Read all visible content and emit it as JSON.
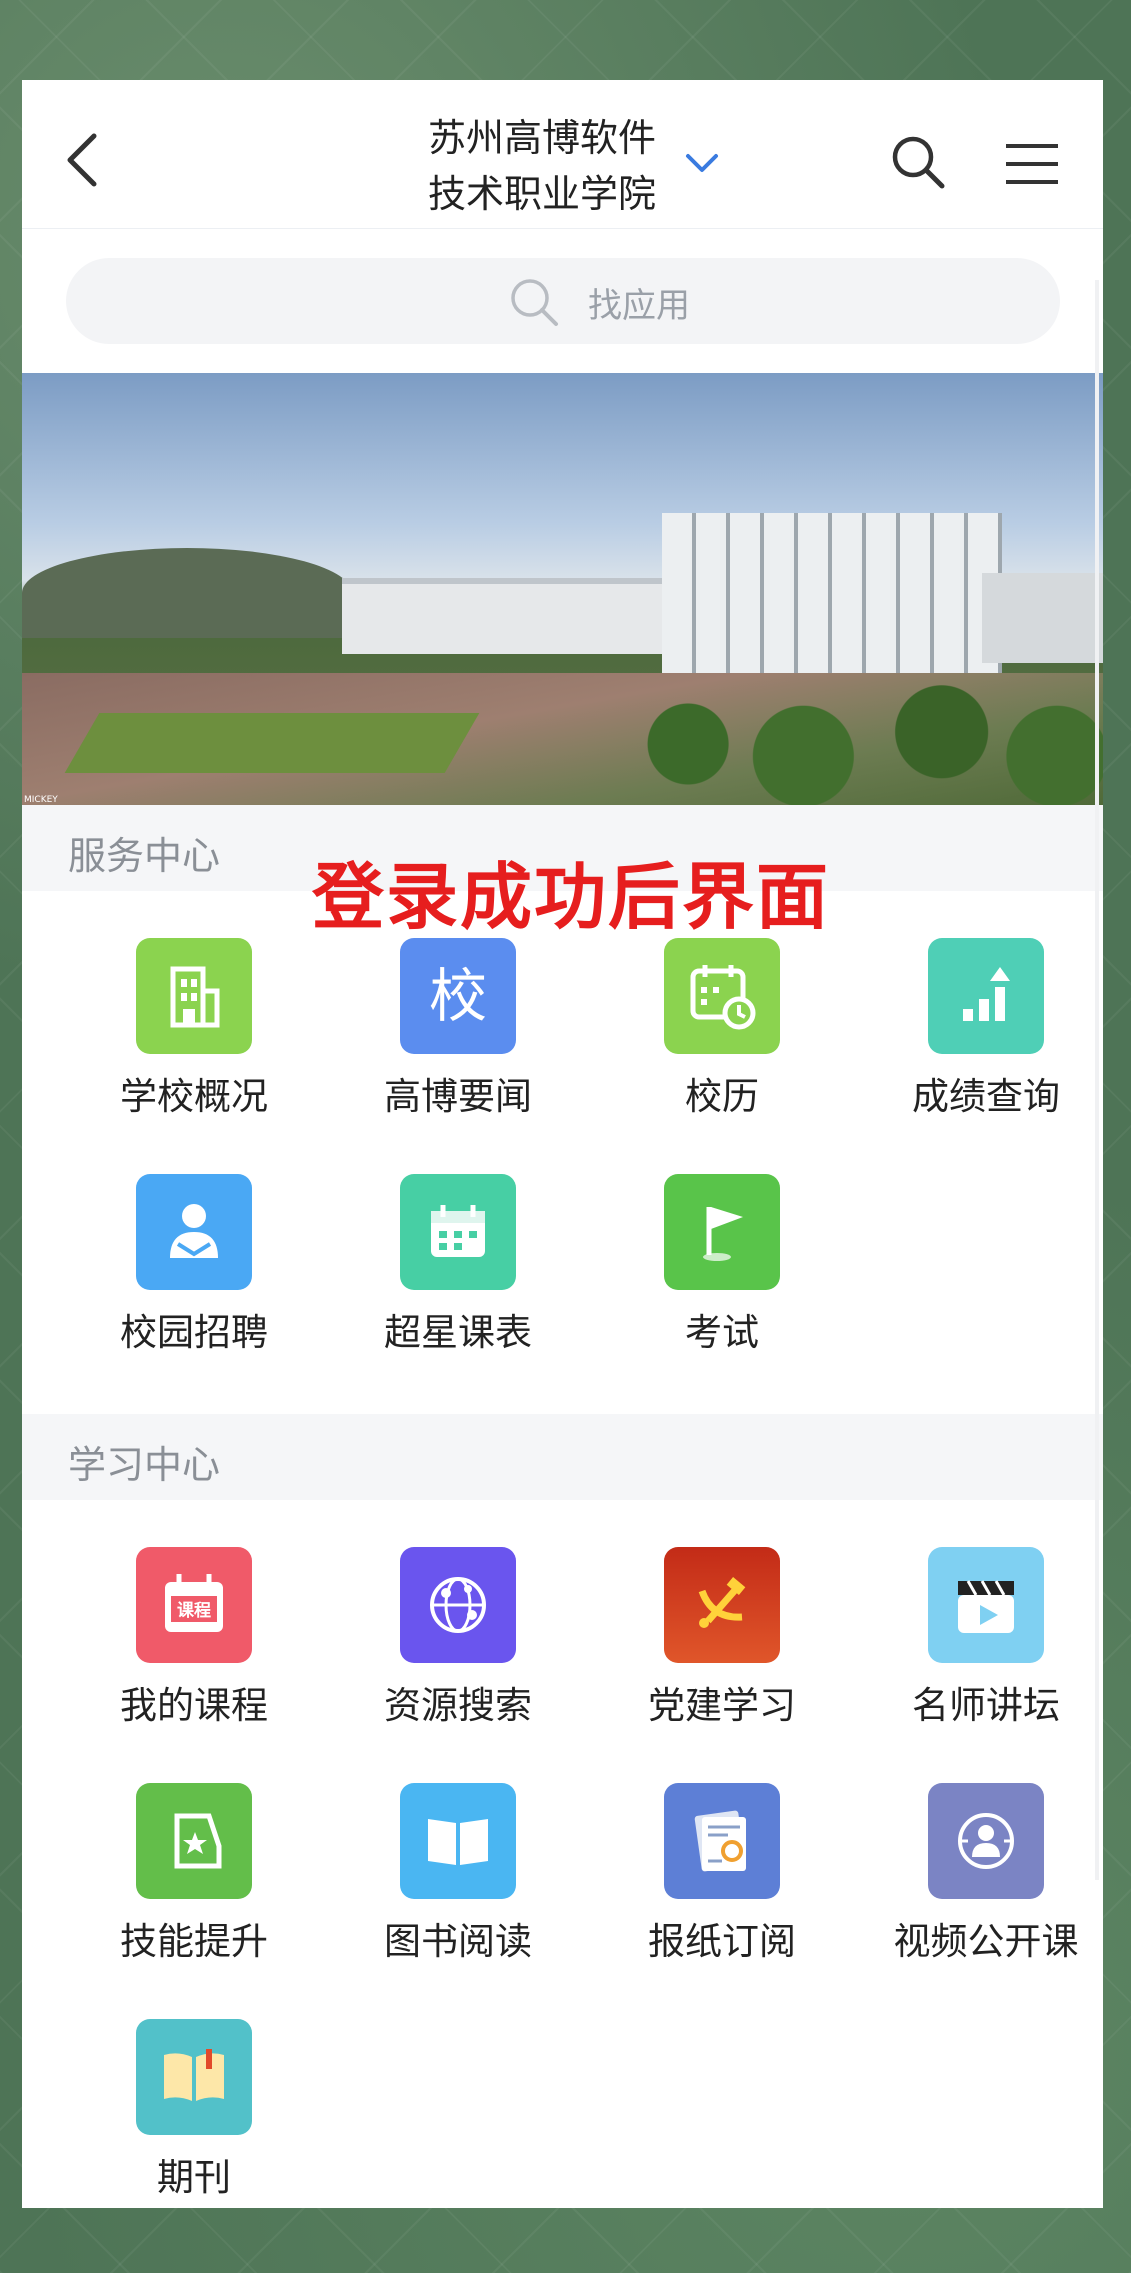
{
  "header": {
    "title_line1": "苏州高博软件",
    "title_line2": "技术职业学院"
  },
  "search": {
    "placeholder": "找应用"
  },
  "banner": {
    "watermark": "MICKEY"
  },
  "overlay": {
    "text": "登录成功后界面"
  },
  "sections": [
    {
      "title": "服务中心",
      "apps": [
        {
          "label": "学校概况",
          "icon": "building-icon",
          "color": "#8bd34f"
        },
        {
          "label": "高博要闻",
          "icon": "school-char-icon",
          "color": "#5b8def"
        },
        {
          "label": "校历",
          "icon": "calendar-clock-icon",
          "color": "#8bd34f"
        },
        {
          "label": "成绩查询",
          "icon": "bar-chart-icon",
          "color": "#4fcfb6"
        },
        {
          "label": "校园招聘",
          "icon": "recruit-person-icon",
          "color": "#4aa8f4"
        },
        {
          "label": "超星课表",
          "icon": "timetable-icon",
          "color": "#47cfa4"
        },
        {
          "label": "考试",
          "icon": "flag-icon",
          "color": "#59c44a"
        }
      ]
    },
    {
      "title": "学习中心",
      "apps": [
        {
          "label": "我的课程",
          "icon": "course-icon",
          "color": "#f05a69",
          "badge": "课程"
        },
        {
          "label": "资源搜索",
          "icon": "globe-network-icon",
          "color": "#6a55ee"
        },
        {
          "label": "党建学习",
          "icon": "party-emblem-icon",
          "color": "#d23b1f"
        },
        {
          "label": "名师讲坛",
          "icon": "video-clapper-icon",
          "color": "#7fd0f2"
        },
        {
          "label": "技能提升",
          "icon": "skill-star-icon",
          "color": "#63be4a"
        },
        {
          "label": "图书阅读",
          "icon": "book-icon",
          "color": "#4ab6f2"
        },
        {
          "label": "报纸订阅",
          "icon": "newspaper-icon",
          "color": "#5d7fd6"
        },
        {
          "label": "视频公开课",
          "icon": "globe-person-icon",
          "color": "#7b84c4"
        },
        {
          "label": "期刊",
          "icon": "journal-icon",
          "color": "#52c1c9"
        }
      ]
    }
  ]
}
